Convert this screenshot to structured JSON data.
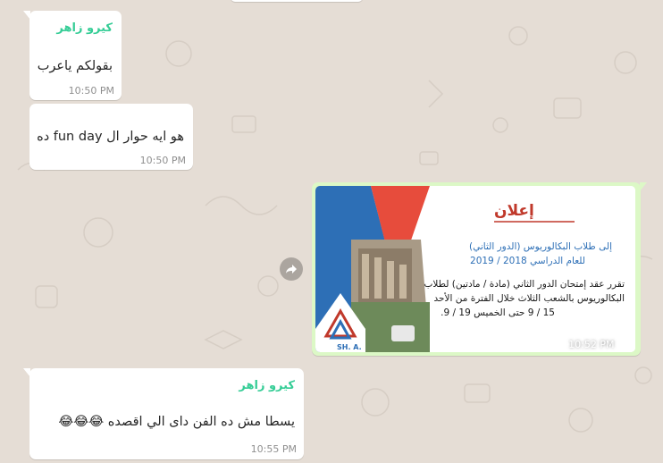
{
  "messages": [
    {
      "sender": "كيرو زاهر",
      "text": "بقولكم ياعرب",
      "time": "10:50 PM"
    },
    {
      "text": "هو ايه حوار ال fun day ده",
      "time": "10:50 PM"
    },
    {
      "sender": "كيرو زاهر",
      "text": "يسطا مش ده الفن داى الي اقصده 😂😂😂",
      "time": "10:55 PM"
    }
  ],
  "image_message": {
    "time": "10:52 PM",
    "status_icon": "double-check-icon",
    "poster": {
      "title": "إعلان",
      "line1": "إلى طلاب البكالوريوس (الدور الثاني)",
      "line2": "للعام الدراسي 2018 / 2019",
      "line3": "تقرر عقد إمتحان الدور الثاني (مادة / مادتين) لطلاب",
      "line4": "البكالوريوس بالشعب الثلاث خلال الفترة من الأحد",
      "line5": "15 / 9 حتى الخميس 19 / 9.",
      "logo_text": "SH. A."
    }
  },
  "colors": {
    "chat_bg": "#e5ddd5",
    "incoming_bubble": "#ffffff",
    "outgoing_bubble": "#dcf8c6",
    "sender_name": "#35cd96"
  }
}
